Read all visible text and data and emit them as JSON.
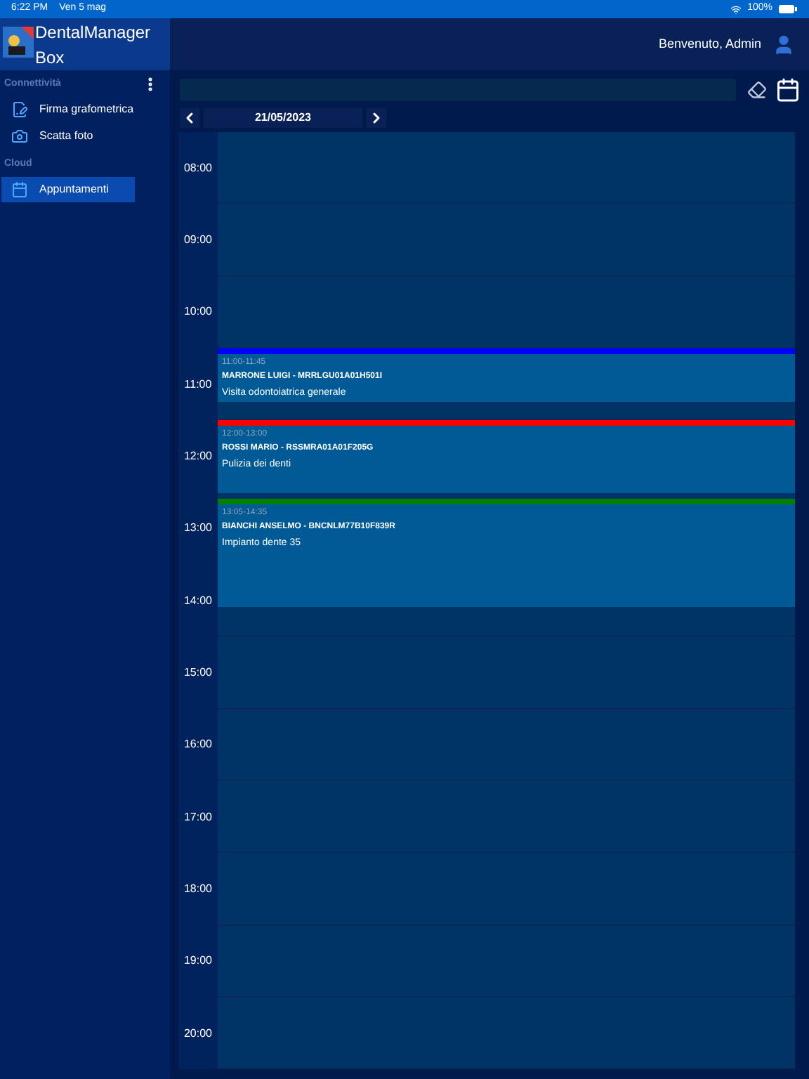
{
  "status_bar": {
    "time": "6:22 PM",
    "date": "Ven 5 mag",
    "battery": "100%"
  },
  "app": {
    "title": "DentalManager Box"
  },
  "header": {
    "welcome": "Benvenuto, Admin"
  },
  "sidebar": {
    "sections": [
      {
        "title": "Connettività",
        "items": [
          {
            "kind": "signature",
            "label": "Firma grafometrica",
            "selected": false
          },
          {
            "kind": "camera",
            "label": "Scatta foto",
            "selected": false
          }
        ]
      },
      {
        "title": "Cloud",
        "items": [
          {
            "kind": "calendar",
            "label": "Appuntamenti",
            "selected": true
          }
        ]
      }
    ]
  },
  "date_nav": {
    "date": "21/05/2023"
  },
  "calendar": {
    "hours": [
      "08:00",
      "09:00",
      "10:00",
      "11:00",
      "12:00",
      "13:00",
      "14:00",
      "15:00",
      "16:00",
      "17:00",
      "18:00",
      "19:00",
      "20:00"
    ],
    "appointments": [
      {
        "time": "11:00-11:45",
        "patient": "MARRONE LUIGI - MRRLGU01A01H501I",
        "treatment": "Visita odontoiatrica generale",
        "color": "#0000ff"
      },
      {
        "time": "12:00-13:00",
        "patient": "ROSSI MARIO - RSSMRA01A01F205G",
        "treatment": "Pulizia dei denti",
        "color": "#ff0000"
      },
      {
        "time": "13:05-14:35",
        "patient": "BIANCHI ANSELMO - BNCNLM77B10F839R",
        "treatment": "Impianto dente 35",
        "color": "#008000"
      }
    ]
  }
}
